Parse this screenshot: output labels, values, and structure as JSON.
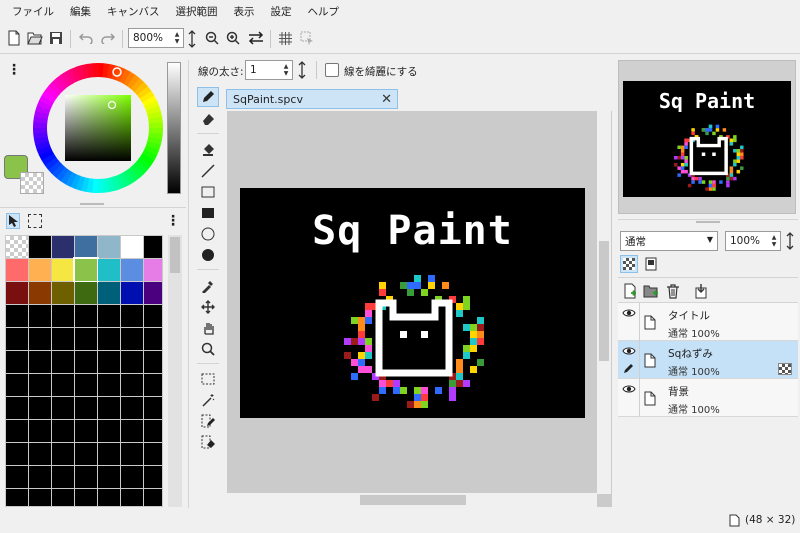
{
  "menu": [
    "ファイル",
    "編集",
    "キャンバス",
    "選択範囲",
    "表示",
    "設定",
    "ヘルプ"
  ],
  "toolbar": {
    "zoom": "800%"
  },
  "options": {
    "line_width_label": "線の太さ:",
    "line_width_value": "1",
    "smooth_label": "線を綺麗にする"
  },
  "tab": {
    "name": "SqPaint.spcv",
    "close": "✕"
  },
  "canvas": {
    "title_text": "Sq Paint"
  },
  "preview": {
    "title_text": "Sq Paint"
  },
  "layers_panel": {
    "blend_mode": "通常",
    "opacity": "100%"
  },
  "layers": [
    {
      "name": "タイトル",
      "mode": "通常 100%",
      "selected": false
    },
    {
      "name": "Sqねずみ",
      "mode": "通常 100%",
      "selected": true
    },
    {
      "name": "背景",
      "mode": "通常 100%",
      "selected": false
    }
  ],
  "status": {
    "size": "(48 × 32)"
  },
  "colors": {
    "accent": "#cde4f7",
    "primary_color": "#8bc34a",
    "background": "#f0f0f0"
  },
  "palette": [
    "transparent",
    "#000000",
    "#2b2f6b",
    "#3f6ea0",
    "#8fb6c9",
    "#ffffff",
    "#000000",
    "#ff6b6b",
    "#ffb050",
    "#f5e642",
    "#8bc34a",
    "#20bfc8",
    "#5b8ee0",
    "#e67ce6",
    "#7a0f0f",
    "#8a3a00",
    "#6e6000",
    "#3e6b12",
    "#00607a",
    "#0010b0",
    "#4b0080"
  ]
}
